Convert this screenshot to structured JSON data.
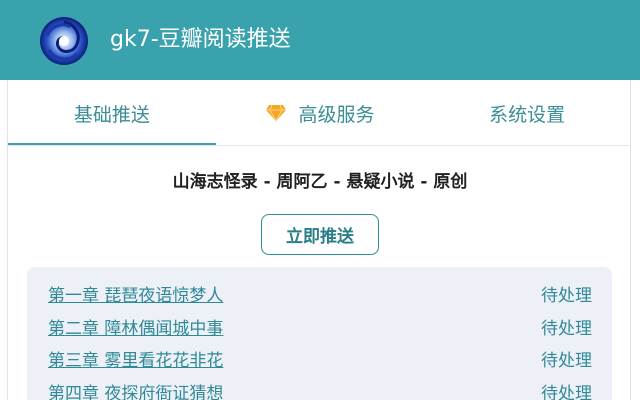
{
  "header": {
    "title": "gk7-豆瓣阅读推送"
  },
  "tabs": [
    {
      "label": "基础推送",
      "active": true
    },
    {
      "label": "高级服务",
      "active": false,
      "icon": "diamond-icon"
    },
    {
      "label": "系统设置",
      "active": false
    }
  ],
  "book": {
    "title": "山海志怪录 - 周阿乙 - 悬疑小说 - 原创"
  },
  "push_button": {
    "label": "立即推送"
  },
  "chapters": [
    {
      "title": "第一章 琵琶夜语惊梦人",
      "status": "待处理"
    },
    {
      "title": "第二章 障林偶闻城中事",
      "status": "待处理"
    },
    {
      "title": "第三章 雾里看花花非花",
      "status": "待处理"
    },
    {
      "title": "第四章 夜探府衙证猜想",
      "status": "待处理"
    }
  ],
  "colors": {
    "header_bg": "#3aa2ad",
    "accent": "#2f8a96",
    "diamond": "#f5a623",
    "list_bg": "#eef0f8"
  }
}
